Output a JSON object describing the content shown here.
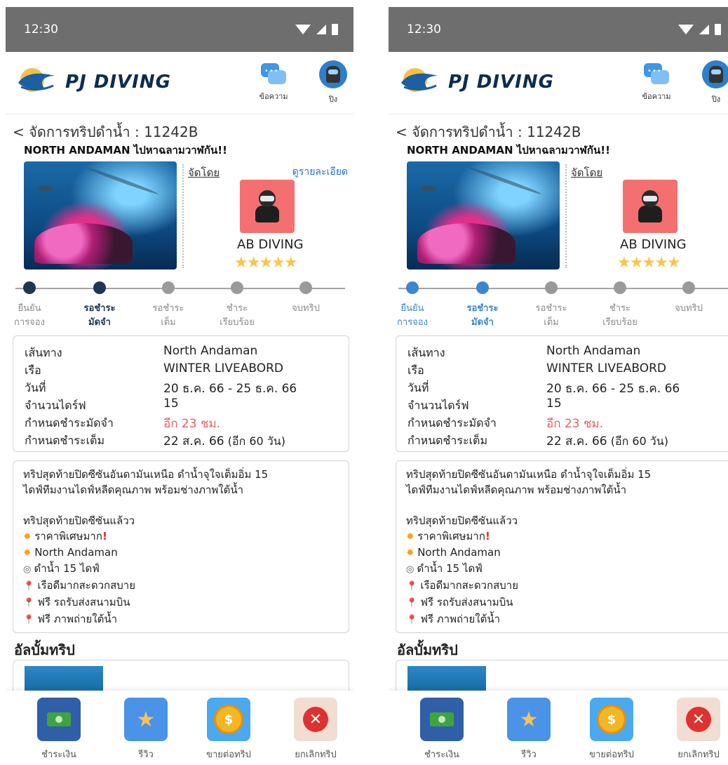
{
  "colors": {
    "status_bar": "#6e6e6e",
    "brand": "#0d2c4f",
    "link": "#1f6fd6",
    "alert": "#f05c5c",
    "star": "#f6c64d",
    "timeline_done_left": "#1f3555",
    "timeline_done_right": "#3b86cd",
    "timeline_pending": "#9a9a9a"
  },
  "screens": [
    {
      "variant": "dark-timeline",
      "status_time": "12:30",
      "brand": "PJ DIVING",
      "header": {
        "messages_label": "ข้อความ",
        "user_label": "ปิง"
      },
      "breadcrumb": "< จัดการทริปดำน้ำ : 11242B",
      "trip_title": "NORTH ANDAMAN ไปหาฉลามวาฬกัน!!",
      "organizer_label": "จัดโดย",
      "detail_link": "ดูรายละเอียด",
      "organizer_name": "AB DIVING",
      "rating": "★★★★★",
      "steps": [
        {
          "label": "ยืนยัน\nการจอง",
          "done": true,
          "current": false
        },
        {
          "label": "รอชำระ\nมัดจำ",
          "done": true,
          "current": true
        },
        {
          "label": "รอชำระ\nเต็ม",
          "done": false,
          "current": false
        },
        {
          "label": "ชำระ\nเรียบร้อย",
          "done": false,
          "current": false
        },
        {
          "label": "จบทริป",
          "done": false,
          "current": false
        }
      ],
      "info": [
        {
          "label": "เส้นทาง",
          "value": "North Andaman"
        },
        {
          "label": "เรือ",
          "value": "WINTER LIVEABORD"
        },
        {
          "label": "วันที่",
          "value": "20 ธ.ค. 66 - 25 ธ.ค. 66"
        },
        {
          "label": "จำนวนไดร์ฟ",
          "value": "15"
        },
        {
          "label": "กำหนดชำระมัดจำ",
          "value": "อีก 23 ชม."
        },
        {
          "label": "กำหนดชำระเต็ม",
          "value": "22 ส.ค. 66",
          "value_extra": "(อีก 60 วัน)"
        }
      ],
      "description": {
        "intro": "ทริปสุดท้ายปิดซีซันอันดามันเหนือ ดำน้ำจุใจเต็มอิ่ม 15",
        "intro2": "ไดฟ์ทีมงานไดฟ์หลีดคุณภาพ พร้อมช่างภาพใต้น้ำ",
        "closing": "ทริปสุดท้ายปิดซีซันแล้วว",
        "bullets": [
          {
            "icon": "✸",
            "text": "ราคาพิเศษมาก",
            "suffix": "!"
          },
          {
            "icon": "✸",
            "text": "North Andaman",
            "suffix": ""
          },
          {
            "icon": "◎",
            "text": "ดำน้ำ 15 ไดฟ์",
            "suffix": ""
          },
          {
            "icon": "📍",
            "text": "เรือดีมากสะดวกสบาย",
            "suffix": ""
          },
          {
            "icon": "📍",
            "text": "ฟรี รถรับส่งสนามบิน",
            "suffix": ""
          },
          {
            "icon": "📍",
            "text": "ฟรี ภาพถ่ายใต้น้ำ",
            "suffix": ""
          }
        ]
      },
      "album_heading": "อัลบั้มทริป",
      "nav": [
        {
          "label": "ชำระเงิน",
          "icon": "payment-icon"
        },
        {
          "label": "รีวิว",
          "icon": "review-icon"
        },
        {
          "label": "ขายต่อทริป",
          "icon": "resell-icon"
        },
        {
          "label": "ยกเลิกทริป",
          "icon": "cancel-icon"
        }
      ]
    },
    {
      "variant": "blue-timeline",
      "status_time": "12:30",
      "brand": "PJ DIVING",
      "header": {
        "messages_label": "ข้อความ",
        "user_label": "ปิง"
      },
      "breadcrumb": "< จัดการทริปดำน้ำ : 11242B",
      "trip_title": "NORTH ANDAMAN ไปหาฉลามวาฬกัน!!",
      "organizer_label": "จัดโดย",
      "detail_link": "",
      "organizer_name": "AB DIVING",
      "rating": "★★★★★",
      "steps": [
        {
          "label": "ยืนยัน\nการจอง",
          "done": true,
          "current": false
        },
        {
          "label": "รอชำระ\nมัดจำ",
          "done": true,
          "current": true
        },
        {
          "label": "รอชำระ\nเต็ม",
          "done": false,
          "current": false
        },
        {
          "label": "ชำระ\nเรียบร้อย",
          "done": false,
          "current": false
        },
        {
          "label": "จบทริป",
          "done": false,
          "current": false
        }
      ],
      "info": [
        {
          "label": "เส้นทาง",
          "value": "North Andaman"
        },
        {
          "label": "เรือ",
          "value": "WINTER LIVEABORD"
        },
        {
          "label": "วันที่",
          "value": "20 ธ.ค. 66 - 25 ธ.ค. 66"
        },
        {
          "label": "จำนวนไดร์ฟ",
          "value": "15"
        },
        {
          "label": "กำหนดชำระมัดจำ",
          "value": "อีก 23 ชม."
        },
        {
          "label": "กำหนดชำระเต็ม",
          "value": "22 ส.ค. 66",
          "value_extra": "(อีก 60 วัน)"
        }
      ],
      "description": {
        "intro": "ทริปสุดท้ายปิดซีซันอันดามันเหนือ ดำน้ำจุใจเต็มอิ่ม 15",
        "intro2": "ไดฟ์ทีมงานไดฟ์หลีดคุณภาพ พร้อมช่างภาพใต้น้ำ",
        "closing": "ทริปสุดท้ายปิดซีซันแล้วว",
        "bullets": [
          {
            "icon": "✸",
            "text": "ราคาพิเศษมาก",
            "suffix": "!"
          },
          {
            "icon": "✸",
            "text": "North Andaman",
            "suffix": ""
          },
          {
            "icon": "◎",
            "text": "ดำน้ำ 15 ไดฟ์",
            "suffix": ""
          },
          {
            "icon": "📍",
            "text": "เรือดีมากสะดวกสบาย",
            "suffix": ""
          },
          {
            "icon": "📍",
            "text": "ฟรี รถรับส่งสนามบิน",
            "suffix": ""
          },
          {
            "icon": "📍",
            "text": "ฟรี ภาพถ่ายใต้น้ำ",
            "suffix": ""
          }
        ]
      },
      "album_heading": "อัลบั้มทริป",
      "nav": [
        {
          "label": "ชำระเงิน",
          "icon": "payment-icon"
        },
        {
          "label": "รีวิว",
          "icon": "review-icon"
        },
        {
          "label": "ขายต่อทริป",
          "icon": "resell-icon"
        },
        {
          "label": "ยกเลิกทริป",
          "icon": "cancel-icon"
        }
      ]
    }
  ]
}
